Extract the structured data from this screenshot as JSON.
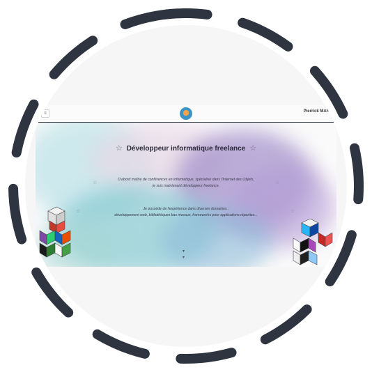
{
  "header": {
    "menu_icon": "hamburger-icon",
    "author": "Pierrick MAR…"
  },
  "hero": {
    "title": "Développeur informatique freelance",
    "paragraph1_line1": "D'abord maître de conférences en informatique, spécialisé dans l'Internet des Objets,",
    "paragraph1_line2": "je suis maintenant développeur freelance.",
    "paragraph2_line1": "Je possède de l'expérience dans diverses domaines :",
    "paragraph2_line2": "développement web, bibliothèques bas niveaux, frameworks pour applications réparties..."
  },
  "colors": {
    "ring": "#2e3440",
    "navbar_border": "#2e3440",
    "text": "#2c2c3a"
  }
}
